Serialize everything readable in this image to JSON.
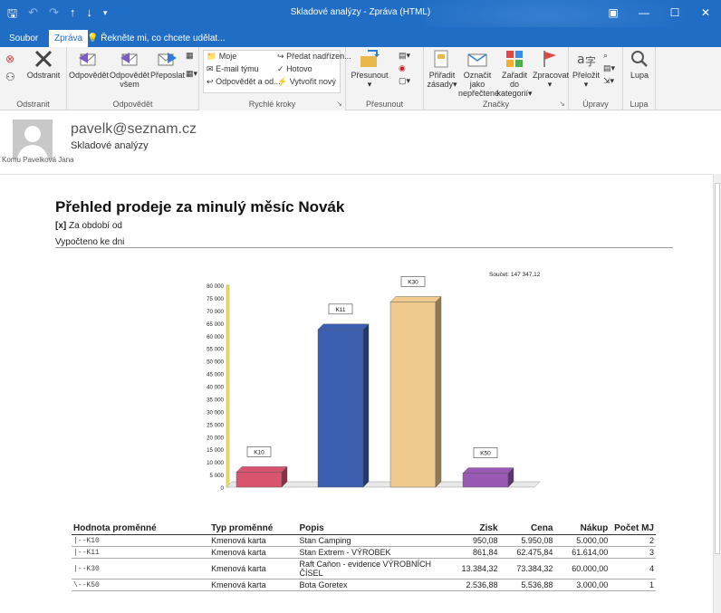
{
  "window": {
    "title": "Skladové analýzy - Zpráva (HTML)"
  },
  "tabs": {
    "file": "Soubor",
    "message": "Zpráva",
    "tell_me": "Řekněte mi, co chcete udělat..."
  },
  "ribbon": {
    "delete_group": {
      "label": "Odstranit",
      "delete_btn": "Odstranit"
    },
    "respond_group": {
      "label": "Odpovědět",
      "reply": "Odpovědět",
      "reply_all_1": "Odpovědět",
      "reply_all_2": "všem",
      "forward": "Přeposlat"
    },
    "quick_steps": {
      "label": "Rychlé kroky",
      "items": [
        "Moje",
        "E-mail týmu",
        "Odpovědět a od...",
        "Předat nadřízen...",
        "Hotovo",
        "Vytvořit nový"
      ]
    },
    "move_group": {
      "label": "Přesunout",
      "move_btn": "Přesunout"
    },
    "tags_group": {
      "label": "Značky",
      "assign_1": "Přiřadit",
      "assign_2": "zásady",
      "unread_1": "Označit jako",
      "unread_2": "nepřečtené",
      "categorize_1": "Zařadit do",
      "categorize_2": "kategorií",
      "followup": "Zpracovat"
    },
    "edit_group": {
      "label": "Úpravy",
      "translate": "Přeložit"
    },
    "zoom_group": {
      "label": "Lupa",
      "zoom_btn": "Lupa"
    }
  },
  "message": {
    "sender": "pavelk@seznam.cz",
    "subject": "Skladové analýzy",
    "recipient_label": "Komu",
    "recipient": "Pavelková Jana"
  },
  "report": {
    "title": "Přehled prodeje za minulý měsíc Novák",
    "period_mark": "[x]",
    "period_text": "Za období od",
    "computed_text": "Vypočteno ke dni"
  },
  "chart_data": {
    "type": "bar",
    "categories": [
      "K10",
      "K11",
      "K30",
      "K50"
    ],
    "values": [
      5950.08,
      62475.84,
      73384.32,
      5536.88
    ],
    "colors": [
      "#d9546f",
      "#3a5fb0",
      "#f0c98e",
      "#9b59b6"
    ],
    "total_label": "Součet: 147 347,12",
    "ylim": [
      0,
      80000
    ],
    "yticks": [
      "0",
      "5 000",
      "10 000",
      "15 000",
      "20 000",
      "25 000",
      "30 000",
      "35 000",
      "40 000",
      "45 000",
      "50 000",
      "55 000",
      "60 000",
      "65 000",
      "70 000",
      "75 000",
      "80 000"
    ],
    "grid": false
  },
  "table": {
    "headers": [
      "Hodnota proměnné",
      "Typ proměnné",
      "Popis",
      "Zisk",
      "Cena",
      "Nákup",
      "Počet MJ"
    ],
    "rows": [
      [
        "|--K10",
        "Kmenová karta",
        "Stan Camping",
        "950,08",
        "5.950,08",
        "5.000,00",
        "2"
      ],
      [
        "|--K11",
        "Kmenová karta",
        "Stan Extrem - VÝROBEK",
        "861,84",
        "62.475,84",
        "61.614,00",
        "3"
      ],
      [
        "|--K30",
        "Kmenová karta",
        "Raft Caňon - evidence VÝROBNÍCH ČÍSEL",
        "13.384,32",
        "73.384,32",
        "60.000,00",
        "4"
      ],
      [
        "\\--K50",
        "Kmenová karta",
        "Bota Goretex",
        "2.536,88",
        "5.536,88",
        "3.000,00",
        "1"
      ]
    ]
  }
}
